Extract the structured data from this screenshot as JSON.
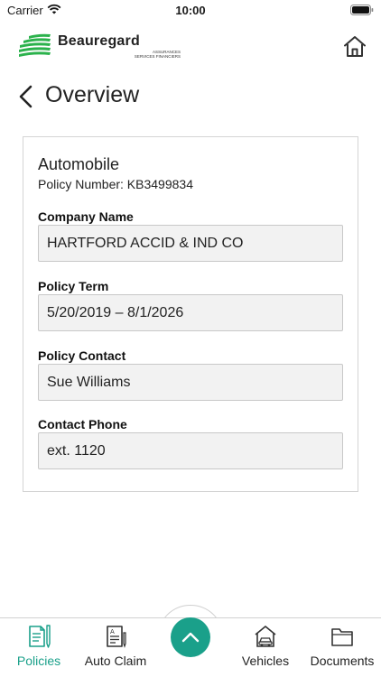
{
  "status_bar": {
    "carrier": "Carrier",
    "time": "10:00"
  },
  "brand": {
    "name": "Beauregard",
    "tagline_1": "ASSURANCES",
    "tagline_2": "SERVICES FINANCIERS"
  },
  "page": {
    "title": "Overview"
  },
  "policy": {
    "type": "Automobile",
    "number": "Policy Number: KB3499834",
    "fields": [
      {
        "label": "Company Name",
        "value": "HARTFORD ACCID & IND CO"
      },
      {
        "label": "Policy Term",
        "value": "5/20/2019 – 8/1/2026"
      },
      {
        "label": "Policy Contact",
        "value": "Sue Williams"
      },
      {
        "label": "Contact Phone",
        "value": "ext. 1120"
      }
    ]
  },
  "tabs": [
    {
      "label": "Policies",
      "active": true
    },
    {
      "label": "Auto Claim",
      "active": false
    },
    {
      "label": "Vehicles",
      "active": false
    },
    {
      "label": "Documents",
      "active": false
    }
  ],
  "colors": {
    "accent": "#1aa08a",
    "brand_green": "#2bb24c"
  }
}
